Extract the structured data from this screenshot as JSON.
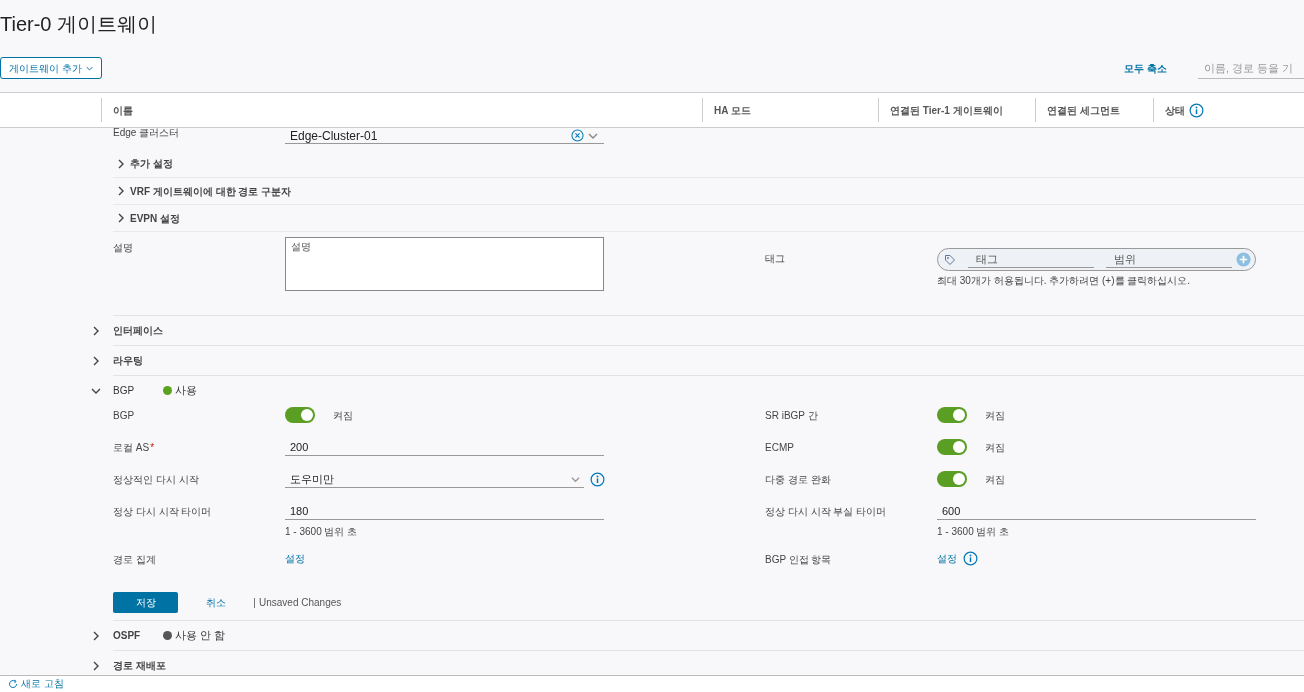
{
  "title": "Tier-0 게이트웨이",
  "add_button": "게이트웨이 추가",
  "collapse_all": "모두 축소",
  "search": {
    "placeholder": "이름, 경로 등을 기"
  },
  "columns": [
    {
      "label": "이름"
    },
    {
      "label": "HA 모드"
    },
    {
      "label": "연결된 Tier-1 게이트웨이"
    },
    {
      "label": "연결된 세그먼트"
    },
    {
      "label": "상태",
      "info": true
    }
  ],
  "edge_cluster": {
    "label": "Edge 클러스터",
    "value": "Edge-Cluster-01"
  },
  "subsections": [
    {
      "label": "추가 설정",
      "expanded": false
    },
    {
      "label": "VRF 게이트웨이에 대한 경로 구분자",
      "expanded": false
    },
    {
      "label": "EVPN 설정",
      "expanded": false
    }
  ],
  "description": {
    "label": "설명",
    "placeholder": "설명"
  },
  "tags": {
    "label": "태그",
    "tag_placeholder": "태그",
    "scope_placeholder": "범위",
    "hint": "최대 30개가 허용됩니다. 추가하려면 (+)를 클릭하십시오."
  },
  "sections": [
    {
      "title": "인터페이스",
      "expanded": false
    },
    {
      "title": "라우팅",
      "expanded": false
    },
    {
      "title": "BGP",
      "expanded": true,
      "status": {
        "label": "사용",
        "color": "#5aa220"
      },
      "fields_left": [
        {
          "kind": "toggle",
          "label": "BGP",
          "on": true,
          "state_label": "켜짐"
        },
        {
          "kind": "input",
          "label": "로컬 AS",
          "required_mark": "*",
          "value": "200"
        },
        {
          "kind": "select",
          "label": "정상적인 다시 시작",
          "value": "도우미만",
          "info": true
        },
        {
          "kind": "input",
          "label": "정상 다시 시작 타이머",
          "value": "180",
          "hint": "1 - 3600 범위 초"
        },
        {
          "kind": "link",
          "label": "경로 집계",
          "value": "설정"
        }
      ],
      "fields_right": [
        {
          "kind": "toggle",
          "label": "SR iBGP 간",
          "on": true,
          "state_label": "켜짐"
        },
        {
          "kind": "toggle",
          "label": "ECMP",
          "on": true,
          "state_label": "켜짐"
        },
        {
          "kind": "toggle",
          "label": "다중 경로 완화",
          "on": true,
          "state_label": "켜짐"
        },
        {
          "kind": "input",
          "label": "정상 다시 시작 부실 타이머",
          "value": "600",
          "hint": "1 - 3600 범위 초"
        },
        {
          "kind": "link",
          "label": "BGP 인접 항목",
          "value": "설정",
          "info": true
        }
      ],
      "actions": {
        "save": "저장",
        "cancel": "취소",
        "note": "Unsaved Changes"
      }
    },
    {
      "title": "OSPF",
      "expanded": false,
      "status": {
        "label": "사용 안 함",
        "color": "#565656"
      }
    },
    {
      "title": "경로 재배포",
      "expanded": false
    }
  ],
  "refresh": "새로 고침"
}
